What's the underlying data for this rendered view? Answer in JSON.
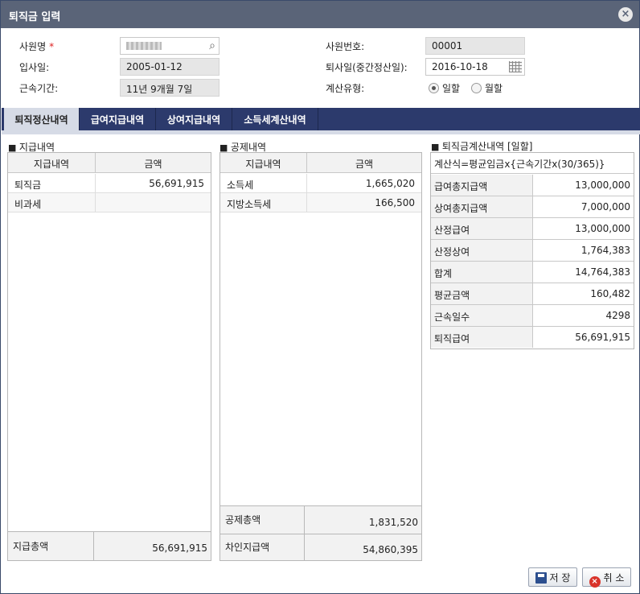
{
  "window": {
    "title": "퇴직금 입력",
    "close_icon": "×"
  },
  "form": {
    "employee_name": {
      "label": "사원명",
      "required_mark": "*"
    },
    "employee_no": {
      "label": "사원번호:",
      "value": "00001"
    },
    "hire_date": {
      "label": "입사일:",
      "value": "2005-01-12"
    },
    "retire_date": {
      "label": "퇴사일(중간정산일):",
      "value": "2016-10-18"
    },
    "service_period": {
      "label": "근속기간:",
      "value": "11년 9개월 7일"
    },
    "calc_type": {
      "label": "계산유형:",
      "options": [
        "일할",
        "월할"
      ],
      "selected": "일할"
    }
  },
  "tabs": [
    "퇴직정산내역",
    "급여지급내역",
    "상여지급내역",
    "소득세계산내역"
  ],
  "payments": {
    "title": "지급내역",
    "headers": [
      "지급내역",
      "금액"
    ],
    "rows": [
      {
        "name": "퇴직금",
        "amount": "56,691,915"
      },
      {
        "name": "비과세",
        "amount": ""
      }
    ],
    "total_label": "지급총액",
    "total_value": "56,691,915"
  },
  "deductions": {
    "title": "공제내역",
    "headers": [
      "지급내역",
      "금액"
    ],
    "rows": [
      {
        "name": "소득세",
        "amount": "1,665,020"
      },
      {
        "name": "지방소득세",
        "amount": "166,500"
      }
    ],
    "total_label": "공제총액",
    "total_value": "1,831,520",
    "net_label": "차인지급액",
    "net_value": "54,860,395"
  },
  "calculation": {
    "title": "퇴직금계산내역 [일할]",
    "formula": "계산식=평균임금x{근속기간x(30/365)}",
    "rows": [
      {
        "label": "급여총지급액",
        "value": "13,000,000"
      },
      {
        "label": "상여총지급액",
        "value": "7,000,000"
      },
      {
        "label": "산정급여",
        "value": "13,000,000"
      },
      {
        "label": "산정상여",
        "value": "1,764,383"
      },
      {
        "label": "합계",
        "value": "14,764,383"
      },
      {
        "label": "평균금액",
        "value": "160,482"
      },
      {
        "label": "근속일수",
        "value": "4298"
      },
      {
        "label": "퇴직급여",
        "value": "56,691,915"
      }
    ]
  },
  "buttons": {
    "save": "저 장",
    "cancel": "취 소"
  }
}
